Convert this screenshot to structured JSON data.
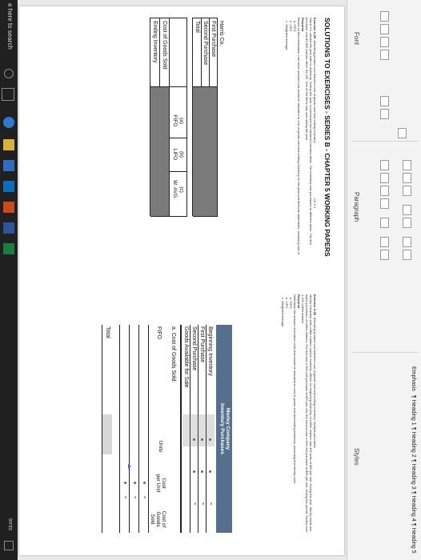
{
  "ribbon": {
    "groups": {
      "font": "Font",
      "paragraph": "Paragraph",
      "styles": "Styles"
    },
    "styles": [
      "Emphasis",
      "¶ Heading 1",
      "¶ Heading 2",
      "¶ Heading 3",
      "¶ Heading 4",
      "¶ Heading 5"
    ]
  },
  "doc": {
    "title": "SOLUTIONS TO EXERCISES - SERIES B - CHAPTER 5 WORKING PAPERS",
    "left": {
      "exercise": "Exercise 5-2B",
      "exercise_title": "Allocating product cost between cost of goods sold and ending inventory",
      "lo": "LO 5-1",
      "body": "Harris Co. started the year with no inventory. During the year, it purchased two identical inventory items. The inventory was purchased at different times. The first purchase cost $3,600 and the other, $4,200. One of the items was sold during the year.",
      "required_label": "Required",
      "required_text": "Based on this information, how much product cost would be allocated to cost of goods sold and ending inventory on the year-end financial statements, assuming use of",
      "opts": [
        "a.  FIFO",
        "b.  LIFO",
        "c.  Weighted average"
      ],
      "table": {
        "company": "Harris Co.",
        "rows": [
          "First Purchase",
          "Second Purchase",
          "Total"
        ],
        "col_letters": [
          "(a)",
          "(b)",
          "(c)"
        ],
        "col_names": [
          "FIFO",
          "LIFO",
          "W. AVG."
        ],
        "bottom_rows": [
          "Cost of Goods Sold",
          "Ending Inventory"
        ]
      }
    },
    "right": {
      "exercise": "Exercise 5-3B",
      "exercise_title": "Allocating product cost between cost of goods sold and ending inventory: multiple purchases",
      "body": "Morley Company sells coffee makers used in business offices. Its beginning inventory of coffee makers was 400 units at $50 per unit. During the year, Morley made two batch purchases of coffee makers. The first was a 500-unit purchase at $55 per unit; the second was a 600-unit purchase at $58 per unit. During the period, Morley sold 1,200 coffee makers.",
      "required_label": "Required",
      "required_text": "Determine the amount of product costs that would be allocated to cost of goods sold and ending inventory, assuming that Morley uses",
      "opts": [
        "a.  FIFO",
        "b.  LIFO",
        "c.  Weighted average"
      ],
      "table": {
        "company": "Morley Company",
        "subtitle": "Inventory Purchases",
        "rows": [
          "Beginning Inventory",
          "First Purchase",
          "Second Purchase",
          "Goods Available for Sale"
        ],
        "cogs_label": "a.  Cost of Goods Sold:",
        "method": "FIFO",
        "col_units": "Units",
        "col_cost": "Cost per Unit",
        "col_total": "Cost of Goods Sold",
        "total_label": "Total"
      }
    }
  },
  "taskbar": {
    "search": "e here to search",
    "tray": "tents"
  }
}
